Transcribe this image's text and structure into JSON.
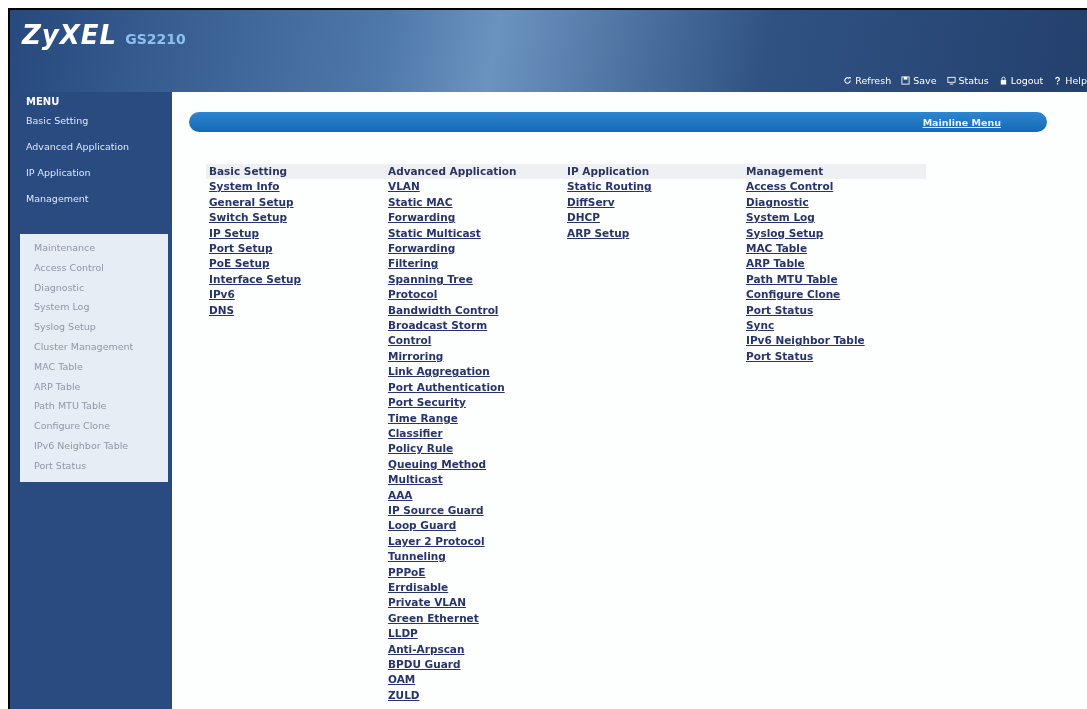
{
  "header": {
    "logo": "ZyXEL",
    "model": "GS2210",
    "links": [
      {
        "kind": "refresh",
        "label": "Refresh"
      },
      {
        "kind": "save",
        "label": "Save"
      },
      {
        "kind": "status",
        "label": "Status"
      },
      {
        "kind": "logout",
        "label": "Logout"
      },
      {
        "kind": "help",
        "label": "Help"
      }
    ]
  },
  "sidebar": {
    "title": "MENU",
    "items": [
      "Basic Setting",
      "Advanced Application",
      "IP Application",
      "Management"
    ],
    "submenu": [
      "Maintenance",
      "Access Control",
      "Diagnostic",
      "System Log",
      "Syslog Setup",
      "Cluster Management",
      "MAC Table",
      "ARP Table",
      "Path MTU Table",
      "Configure Clone",
      "IPv6 Neighbor Table",
      "Port Status"
    ]
  },
  "title_bar": {
    "link": "Mainline Menu"
  },
  "columns": [
    {
      "heading": "Basic Setting",
      "links": [
        "System Info",
        "General Setup",
        "Switch Setup",
        "IP Setup",
        "Port Setup",
        "PoE Setup",
        "Interface Setup",
        "IPv6",
        "DNS"
      ]
    },
    {
      "heading": "Advanced Application",
      "links": [
        "VLAN",
        "Static MAC",
        "Forwarding",
        "Static Multicast",
        "Forwarding",
        "Filtering",
        "Spanning Tree",
        "Protocol",
        "Bandwidth Control",
        "Broadcast Storm",
        "Control",
        "Mirroring",
        "Link Aggregation",
        "Port Authentication",
        "Port Security",
        "Time Range",
        "Classifier",
        "Policy Rule",
        "Queuing Method",
        "Multicast",
        "AAA",
        "IP Source Guard",
        "Loop Guard",
        "Layer 2 Protocol",
        "Tunneling",
        "PPPoE",
        "Errdisable",
        "Private VLAN",
        "Green Ethernet",
        "LLDP",
        "Anti-Arpscan",
        "BPDU Guard",
        "OAM",
        "ZULD"
      ]
    },
    {
      "heading": "IP Application",
      "links": [
        "Static Routing",
        "DiffServ",
        "DHCP",
        "ARP Setup"
      ]
    },
    {
      "heading": "Management",
      "links": [
        "Access Control",
        "Diagnostic",
        "System Log",
        "Syslog Setup",
        "MAC Table",
        "ARP Table",
        "Path MTU Table",
        "Configure Clone",
        "Port Status",
        "Sync",
        "IPv6 Neighbor Table",
        "Port Status"
      ]
    }
  ]
}
